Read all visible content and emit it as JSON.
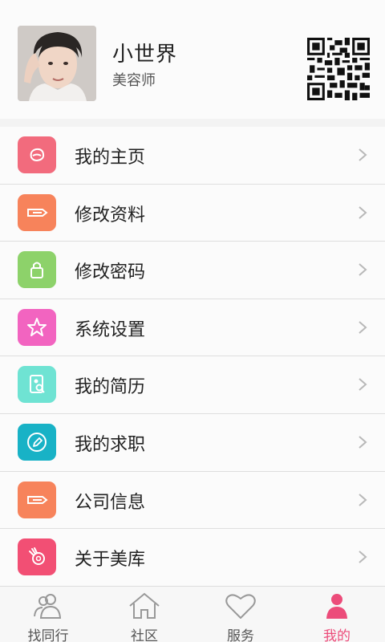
{
  "profile": {
    "name": "小世界",
    "role": "美容师"
  },
  "menu": [
    {
      "label": "我的主页",
      "icon": "home-bubble-icon",
      "color": "#f26b7d"
    },
    {
      "label": "修改资料",
      "icon": "pencil-icon",
      "color": "#f7835b"
    },
    {
      "label": "修改密码",
      "icon": "lock-icon",
      "color": "#8dd26a"
    },
    {
      "label": "系统设置",
      "icon": "star-icon",
      "color": "#f264c0"
    },
    {
      "label": "我的简历",
      "icon": "resume-search-icon",
      "color": "#6fe3d3"
    },
    {
      "label": "我的求职",
      "icon": "edit-circle-icon",
      "color": "#18b2c6"
    },
    {
      "label": "公司信息",
      "icon": "pencil-icon",
      "color": "#f7835b"
    },
    {
      "label": "关于美库",
      "icon": "hand-ok-icon",
      "color": "#f24f74"
    }
  ],
  "tabs": [
    {
      "label": "找同行",
      "icon": "people-icon",
      "active": false
    },
    {
      "label": "社区",
      "icon": "house-icon",
      "active": false
    },
    {
      "label": "服务",
      "icon": "heart-icon",
      "active": false
    },
    {
      "label": "我的",
      "icon": "person-icon",
      "active": true
    }
  ],
  "colors": {
    "accent": "#ec4c7a"
  }
}
